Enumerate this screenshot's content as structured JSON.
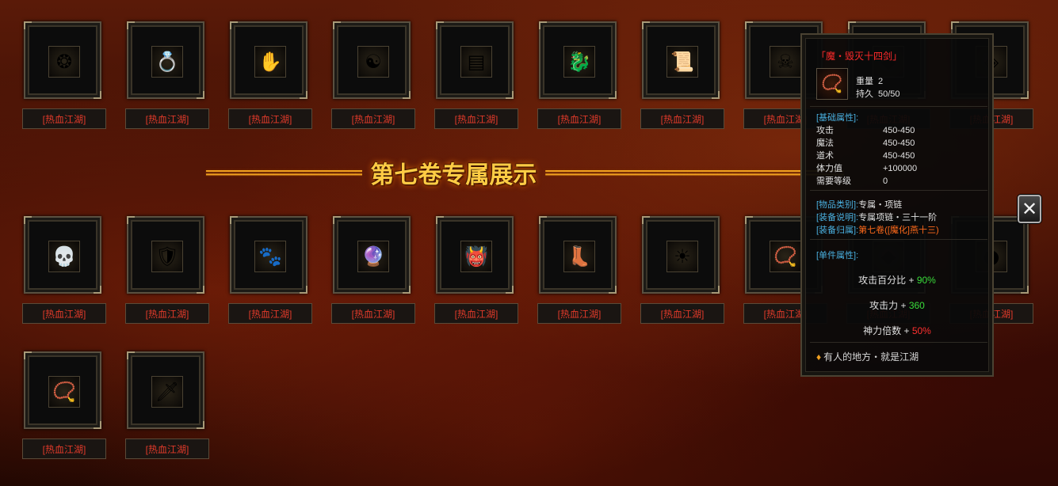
{
  "colors": {
    "label_red": "#e23a2a",
    "banner_gold": "#ffcc44",
    "stat_blue": "#4ab0e0",
    "bonus_green": "#3adc3a",
    "bonus_red": "#ff3030"
  },
  "banner": {
    "left": "=====================",
    "title": "第七卷专属展示",
    "right": "========================================"
  },
  "item_label": "[热血江湖]",
  "rows": [
    [
      "amulet-blue-icon",
      "ring-green-gem-icon",
      "flame-glove-icon",
      "yin-yang-orb-icon",
      "silver-scroll-icon",
      "dragon-jade-icon",
      "golden-talisman-icon",
      "green-skull-icon",
      "item-9-icon",
      "item-10-icon"
    ],
    [
      "skull-icon",
      "red-shield-icon",
      "beast-claw-icon",
      "purple-crystal-icon",
      "demon-mask-icon",
      "jade-boots-icon",
      "gold-emblem-icon",
      "red-necklace-icon",
      "item-19-icon",
      "green-orb-icon"
    ],
    [
      "bead-bracelet-icon",
      "violet-blade-icon"
    ]
  ],
  "row_glyphs": [
    [
      "❂",
      "💍",
      "✋",
      "☯",
      "▤",
      "🐉",
      "📜",
      "☠",
      "◆",
      "◈"
    ],
    [
      "💀",
      "🛡",
      "🐾",
      "🔮",
      "👹",
      "👢",
      "☀",
      "📿",
      "◆",
      "●"
    ],
    [
      "📿",
      "🗡"
    ]
  ],
  "tooltip": {
    "name": "「魔・毁灭十四剑」",
    "thumb_icon": "red-necklace-icon",
    "thumb_glyph": "📿",
    "weight_label": "重量",
    "weight_value": "2",
    "durability_label": "持久",
    "durability_value": "50/50",
    "base_section": "[基础属性]:",
    "base_stats": [
      {
        "k": "攻击",
        "v": "450-450"
      },
      {
        "k": "魔法",
        "v": "450-450"
      },
      {
        "k": "道术",
        "v": "450-450"
      },
      {
        "k": "体力值",
        "v": "+100000"
      },
      {
        "k": "需要等级",
        "v": "0"
      }
    ],
    "info": [
      {
        "k": "[物品类别]:",
        "v": "专属・项链"
      },
      {
        "k": "[装备说明]:",
        "v": "专属项链・三十一阶"
      },
      {
        "k": "[装备归属]:",
        "v": "第七卷([魔化]燕十三)"
      }
    ],
    "set_section": "[单件属性]:",
    "set_stats": [
      {
        "k": "攻击百分比 + ",
        "v": "90%",
        "c": "g"
      },
      {
        "k": "攻击力 + ",
        "v": "360",
        "c": "g"
      },
      {
        "k": "神力倍数 + ",
        "v": "50%",
        "c": "r"
      }
    ],
    "footer": "有人的地方・就是江湖"
  },
  "close_label": "✕"
}
